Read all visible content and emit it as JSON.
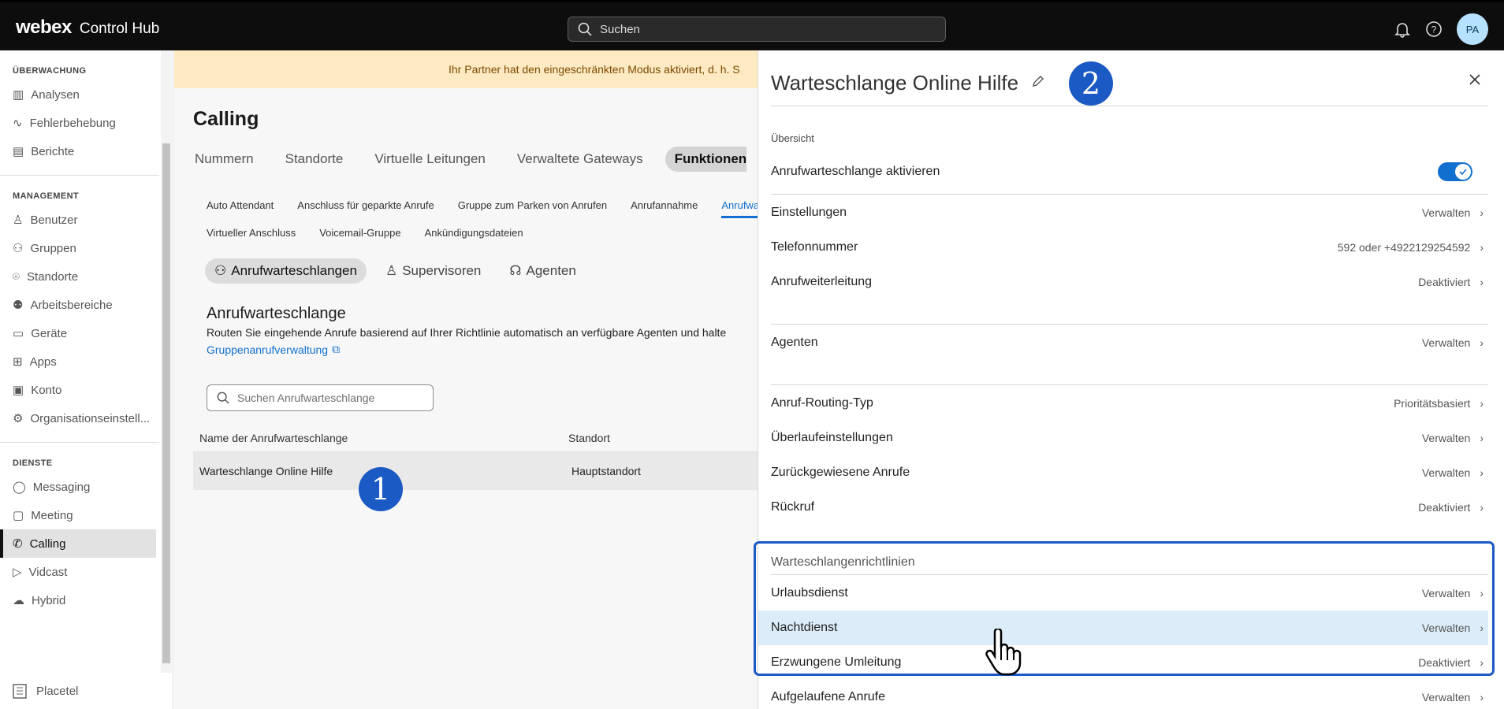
{
  "header": {
    "brand_webex": "webex",
    "brand_product": "Control Hub",
    "search_placeholder": "Suchen",
    "avatar": "PA"
  },
  "sidebar": {
    "sections": [
      {
        "title": "ÜBERWACHUNG",
        "items": [
          {
            "label": "Analysen",
            "icon": "chart-icon"
          },
          {
            "label": "Fehlerbehebung",
            "icon": "pulse-icon"
          },
          {
            "label": "Berichte",
            "icon": "document-icon"
          }
        ]
      },
      {
        "title": "MANAGEMENT",
        "items": [
          {
            "label": "Benutzer",
            "icon": "user-icon"
          },
          {
            "label": "Gruppen",
            "icon": "users-icon"
          },
          {
            "label": "Standorte",
            "icon": "location-icon"
          },
          {
            "label": "Arbeitsbereiche",
            "icon": "workspace-icon"
          },
          {
            "label": "Geräte",
            "icon": "device-icon"
          },
          {
            "label": "Apps",
            "icon": "apps-icon"
          },
          {
            "label": "Konto",
            "icon": "account-icon"
          },
          {
            "label": "Organisationseinstell...",
            "icon": "gear-icon"
          }
        ]
      },
      {
        "title": "DIENSTE",
        "items": [
          {
            "label": "Messaging",
            "icon": "chat-icon"
          },
          {
            "label": "Meeting",
            "icon": "calendar-icon"
          },
          {
            "label": "Calling",
            "icon": "phone-icon",
            "active": true
          },
          {
            "label": "Vidcast",
            "icon": "play-icon"
          },
          {
            "label": "Hybrid",
            "icon": "cloud-icon"
          }
        ]
      }
    ],
    "footer": "Placetel"
  },
  "main": {
    "banner": "Ihr Partner hat den eingeschränkten Modus aktiviert, d. h. S",
    "title": "Calling",
    "tabs": [
      "Nummern",
      "Standorte",
      "Virtuelle Leitungen",
      "Verwaltete Gateways",
      "Funktionen"
    ],
    "subtabs_row1": [
      "Auto Attendant",
      "Anschluss für geparkte Anrufe",
      "Gruppe zum Parken von Anrufen",
      "Anrufannahme",
      "Anrufwart"
    ],
    "subtabs_row2": [
      "Virtueller Anschluss",
      "Voicemail-Gruppe",
      "Ankündigungsdateien"
    ],
    "pills": [
      "Anrufwarteschlangen",
      "Supervisoren",
      "Agenten"
    ],
    "section_title": "Anrufwarteschlange",
    "section_desc": "Routen Sie eingehende Anrufe basierend auf Ihrer Richtlinie automatisch an verfügbare Agenten und halte",
    "link": "Gruppenanrufverwaltung",
    "search_placeholder": "Suchen Anrufwarteschlange",
    "columns": [
      "Name der Anrufwarteschlange",
      "Standort"
    ],
    "row": {
      "name": "Warteschlange Online Hilfe",
      "location": "Hauptstandort"
    }
  },
  "badges": {
    "one": "1",
    "two": "2"
  },
  "panel": {
    "title": "Warteschlange Online Hilfe",
    "overview_label": "Übersicht",
    "enable_label": "Anrufwarteschlange aktivieren",
    "enabled": true,
    "rows_a": [
      {
        "label": "Einstellungen",
        "value": "Verwalten"
      },
      {
        "label": "Telefonnummer",
        "value": "592 oder +4922129254592"
      },
      {
        "label": "Anrufweiterleitung",
        "value": "Deaktiviert"
      }
    ],
    "row_agents": {
      "label": "Agenten",
      "value": "Verwalten"
    },
    "rows_b": [
      {
        "label": "Anruf-Routing-Typ",
        "value": "Prioritätsbasiert"
      },
      {
        "label": "Überlaufeinstellungen",
        "value": "Verwalten"
      },
      {
        "label": "Zurückgewiesene Anrufe",
        "value": "Verwalten"
      },
      {
        "label": "Rückruf",
        "value": "Deaktiviert"
      }
    ],
    "policies_label": "Warteschlangenrichtlinien",
    "rows_c": [
      {
        "label": "Urlaubsdienst",
        "value": "Verwalten"
      },
      {
        "label": "Nachtdienst",
        "value": "Verwalten"
      },
      {
        "label": "Erzwungene Umleitung",
        "value": "Deaktiviert"
      },
      {
        "label": "Aufgelaufene Anrufe",
        "value": "Verwalten"
      }
    ]
  },
  "colors": {
    "accent": "#1170cf",
    "badge": "#1b59c4",
    "highlight": "#1b59c4",
    "banner": "#fde9c2"
  }
}
